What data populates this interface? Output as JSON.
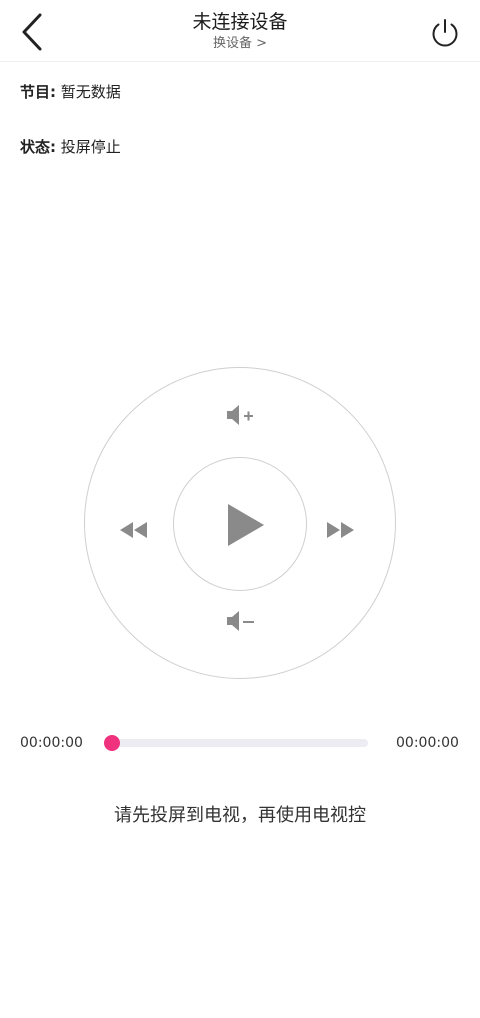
{
  "header": {
    "title": "未连接设备",
    "switch_device": "换设备 >",
    "back_icon": "chevron-left-icon",
    "power_icon": "power-icon"
  },
  "info": {
    "program_key": "节目:",
    "program_value": "暂无数据",
    "status_key": "状态:",
    "status_value": "投屏停止"
  },
  "remote": {
    "icons": [
      "volume-up-icon",
      "volume-down-icon",
      "rewind-icon",
      "fast-forward-icon",
      "play-icon"
    ]
  },
  "progress": {
    "current_time": "00:00:00",
    "total_time": "00:00:00",
    "fraction": 0,
    "accent_color": "#f0317e"
  },
  "hint": "请先投屏到电视，再使用电视控"
}
